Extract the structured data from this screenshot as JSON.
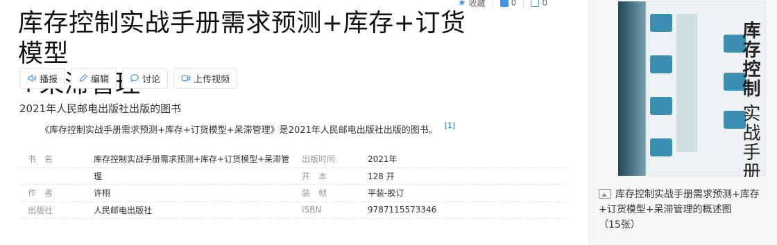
{
  "header": {
    "collect_label": "收藏",
    "like_count": "0",
    "share_count": "0"
  },
  "entry": {
    "title_line1": "库存控制实战手册需求预测+库存+订货模型",
    "title_line2": "+呆滞管理"
  },
  "toolbar": {
    "broadcast": "播报",
    "edit": "编辑",
    "discuss": "讨论",
    "upload_video": "上传视频"
  },
  "summary": {
    "subtitle": "2021年人民邮电出版社出版的图书",
    "intro": "《库存控制实战手册需求预测+库存+订货模型+呆滞管理》是2021年人民邮电出版社出版的图书。",
    "ref": "[1]"
  },
  "info": {
    "rows": [
      {
        "l1": "书　名",
        "v1": "库存控制实战手册需求预测+库存+订货模型+呆滞管",
        "l2": "出版时间",
        "v2": "2021年"
      },
      {
        "l1": "",
        "v1": "理",
        "l2": "开　本",
        "v2": "128 开"
      },
      {
        "l1": "作　者",
        "v1": "许栩",
        "l2": "装　帧",
        "v2": "平装-胶订"
      },
      {
        "l1": "出版社",
        "v1": "人民邮电出版社",
        "l2": "ISBN",
        "v2": "9787115573346"
      }
    ]
  },
  "sidebar": {
    "caption": "库存控制实战手册需求预测+库存+订货模型+呆滞管理的概述图",
    "count": "（15张）",
    "cover_title": "库存控制实战手册"
  }
}
